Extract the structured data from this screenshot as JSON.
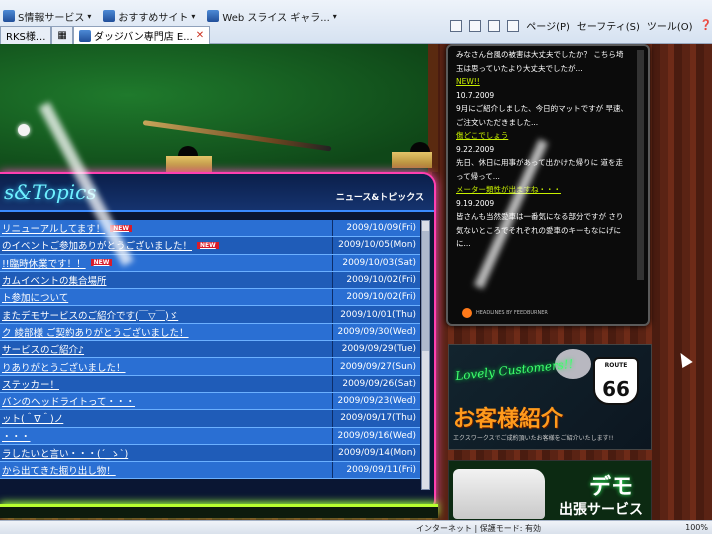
{
  "browser": {
    "favorites": [
      {
        "label": "S情報サービス"
      },
      {
        "label": "おすすめサイト"
      },
      {
        "label": "Web スライス ギャラ..."
      }
    ],
    "tabs": [
      {
        "label": "RKS様..."
      },
      {
        "label": "ダッジバン専門店 E..."
      }
    ],
    "command_bar": {
      "page": "ページ(P)",
      "safety": "セーフティ(S)",
      "tools": "ツール(O)"
    },
    "status": {
      "zone": "インターネット | 保護モード: 有効",
      "zoom": "100%"
    }
  },
  "news": {
    "logo_text": "s&Topics",
    "title": "ニュース&トピックス",
    "new_badge": "NEW",
    "items": [
      {
        "title": "リニューアルしてます！",
        "date": "2009/10/09(Fri)",
        "new": true
      },
      {
        "title": "のイベントご参加ありがとうございました！",
        "date": "2009/10/05(Mon)",
        "new": true
      },
      {
        "title": "!!臨時休業です！！",
        "date": "2009/10/03(Sat)",
        "new": true
      },
      {
        "title": "カムイベントの集合場所",
        "date": "2009/10/02(Fri)",
        "new": false
      },
      {
        "title": "ト参加について",
        "date": "2009/10/02(Fri)",
        "new": false
      },
      {
        "title": "またデモサービスのご紹介です(￣▽￣)ゞ",
        "date": "2009/10/01(Thu)",
        "new": false
      },
      {
        "title": "ク 綾部様 ご契約ありがとうございました！",
        "date": "2009/09/30(Wed)",
        "new": false
      },
      {
        "title": "サービスのご紹介♪",
        "date": "2009/09/29(Tue)",
        "new": false
      },
      {
        "title": "りありがとうございました！",
        "date": "2009/09/27(Sun)",
        "new": false
      },
      {
        "title": "ステッカー！",
        "date": "2009/09/26(Sat)",
        "new": false
      },
      {
        "title": "バンのヘッドライトって・・・",
        "date": "2009/09/23(Wed)",
        "new": false
      },
      {
        "title": "ット(＾∇＾)ノ",
        "date": "2009/09/17(Thu)",
        "new": false
      },
      {
        "title": "・・・",
        "date": "2009/09/16(Wed)",
        "new": false
      },
      {
        "title": "ラしたいと言い・・・(´_ゝ`)",
        "date": "2009/09/14(Mon)",
        "new": false
      },
      {
        "title": "から出てきた掘り出し物！",
        "date": "2009/09/11(Fri)",
        "new": false
      }
    ]
  },
  "blog": {
    "lines": [
      {
        "kind": "text",
        "text": "みなさん台風の被害は大丈夫でしたか？ こちら埼"
      },
      {
        "kind": "text",
        "text": "玉は思っていたより大丈夫でしたが..."
      },
      {
        "kind": "title",
        "text": "NEW!!"
      },
      {
        "kind": "date",
        "text": "10.7.2009"
      },
      {
        "kind": "text",
        "text": "9月にご紹介しました、今日的マットですが 早速、"
      },
      {
        "kind": "text",
        "text": "ご注文いただきました..."
      },
      {
        "kind": "title",
        "text": "傷どこでしょう"
      },
      {
        "kind": "date",
        "text": "9.22.2009"
      },
      {
        "kind": "text",
        "text": "先日、休日に用事があって出かけた帰りに 道を走"
      },
      {
        "kind": "text",
        "text": "って帰って..."
      },
      {
        "kind": "title",
        "text": "メーター類性が出ますね・・・"
      },
      {
        "kind": "date",
        "text": "9.19.2009"
      },
      {
        "kind": "text",
        "text": "皆さんも当然愛車は一番気になる部分ですが さり"
      },
      {
        "kind": "text",
        "text": "気ないところでそれぞれの愛車のキーもなにげに"
      },
      {
        "kind": "text",
        "text": "に..."
      }
    ],
    "footer": "HEADLINES BY FEEDBURNER"
  },
  "customers": {
    "script": "Lovely Customers!!",
    "title": "お客様紹介",
    "subtitle": "エクスワークスでご成約頂いたお客様をご紹介いたします!!",
    "route_top": "ROUTE",
    "route_num": "66"
  },
  "demo": {
    "title": "デモ",
    "subtitle": "出張サービス"
  },
  "colors": {
    "neon_pink": "#ff3fb0",
    "neon_cyan": "#6ef0ff",
    "news_row_a": "#2a6fd3",
    "news_row_b": "#1f5cb8",
    "blog_title": "#c8f000",
    "customers_title": "#ff9a1c"
  }
}
